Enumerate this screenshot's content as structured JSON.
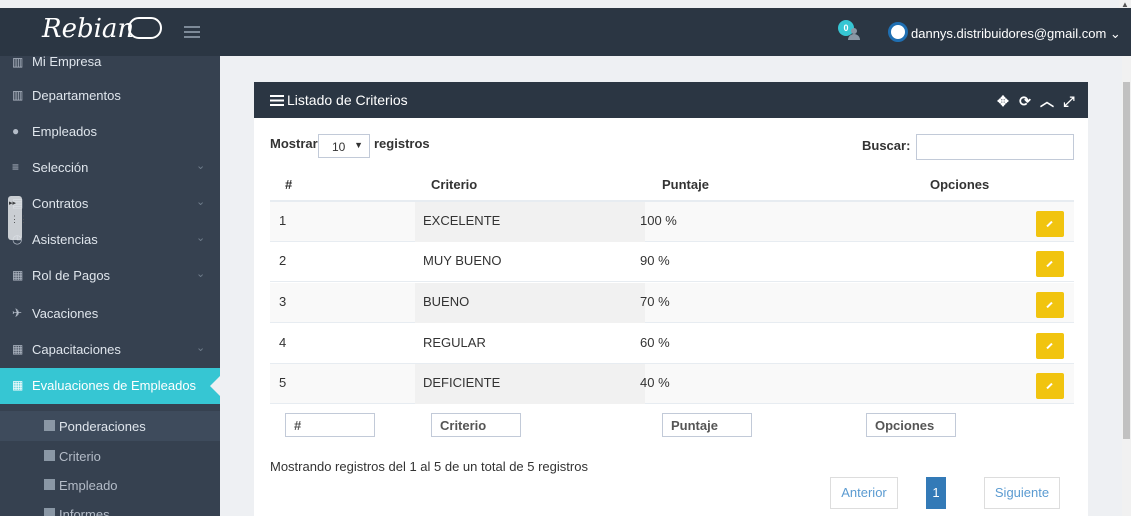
{
  "brand": {
    "name": "Rebian"
  },
  "topbar": {
    "notification_count": "0",
    "user_email": "dannys.distribuidores@gmail.com",
    "user_chevron": "⌄"
  },
  "sidebar": {
    "items": [
      {
        "label": "Mi Empresa",
        "icon": "bank-icon"
      },
      {
        "label": "Departamentos",
        "icon": "bank-icon"
      },
      {
        "label": "Empleados",
        "icon": "users-icon"
      },
      {
        "label": "Selección",
        "icon": "list-icon",
        "chevron": "⌄"
      },
      {
        "label": "Contratos",
        "icon": "file-icon",
        "chevron": "⌄"
      },
      {
        "label": "Asistencias",
        "icon": "clock-icon",
        "chevron": "⌄"
      },
      {
        "label": "Rol de Pagos",
        "icon": "table-icon",
        "chevron": "⌄"
      },
      {
        "label": "Vacaciones",
        "icon": "plane-icon"
      },
      {
        "label": "Capacitaciones",
        "icon": "table-icon",
        "chevron": "⌄"
      },
      {
        "label": "Evaluaciones de Empleados",
        "icon": "table-icon"
      }
    ],
    "subitems": [
      {
        "label": "Ponderaciones"
      },
      {
        "label": "Criterio"
      },
      {
        "label": "Empleado"
      },
      {
        "label": "Informes"
      }
    ]
  },
  "portlet": {
    "title": "Listado de Criterios",
    "tools": [
      "✥",
      "⟳",
      "︿",
      "⤢"
    ]
  },
  "controls": {
    "show_label": "Mostrar",
    "page_size": "10",
    "select_arrow": "▼",
    "records_label": "registros",
    "search_label": "Buscar:"
  },
  "table": {
    "headers": [
      "#",
      "Criterio",
      "Puntaje",
      "Opciones"
    ],
    "rows": [
      {
        "num": "1",
        "criterio": "EXCELENTE",
        "puntaje": "100 %"
      },
      {
        "num": "2",
        "criterio": "MUY BUENO",
        "puntaje": "90 %"
      },
      {
        "num": "3",
        "criterio": "BUENO",
        "puntaje": "70 %"
      },
      {
        "num": "4",
        "criterio": "REGULAR",
        "puntaje": "60 %"
      },
      {
        "num": "5",
        "criterio": "DEFICIENTE",
        "puntaje": "40 %"
      }
    ],
    "filters": [
      "#",
      "Criterio",
      "Puntaje",
      "Opciones"
    ]
  },
  "footer": {
    "info": "Mostrando registros del 1 al 5 de un total de 5 registros",
    "prev": "Anterior",
    "current_page": "1",
    "next": "Siguiente"
  },
  "colors": {
    "accent": "#36c6d3",
    "edit_button": "#f1c40f",
    "header_dark": "#2b3643",
    "sidebar": "#364150"
  }
}
